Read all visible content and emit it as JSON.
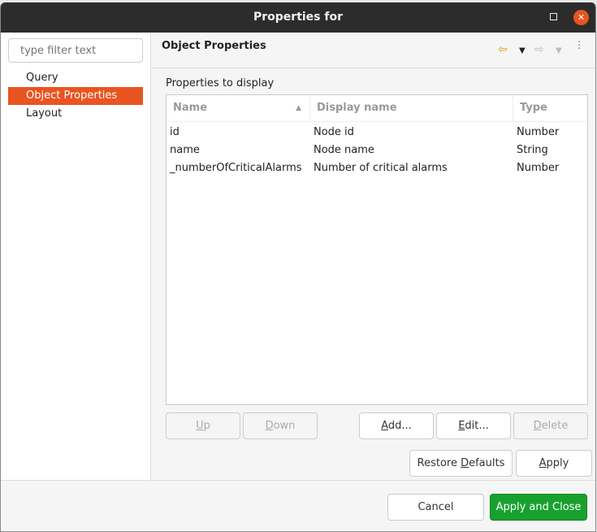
{
  "window": {
    "title": "Properties for"
  },
  "sidebar": {
    "filter_placeholder": "type filter text",
    "items": [
      {
        "label": "Query"
      },
      {
        "label": "Object Properties"
      },
      {
        "label": "Layout"
      }
    ]
  },
  "page": {
    "title": "Object Properties",
    "subtitle": "Properties to display"
  },
  "table": {
    "columns": [
      {
        "label": "Name"
      },
      {
        "label": "Display name"
      },
      {
        "label": "Type"
      }
    ],
    "sort_indicator": "▲",
    "rows": [
      {
        "name": "id",
        "display": "Node id",
        "type": "Number"
      },
      {
        "name": "name",
        "display": "Node name",
        "type": "String"
      },
      {
        "name": "_numberOfCriticalAlarms",
        "display": "Number of critical alarms",
        "type": "Number"
      }
    ]
  },
  "buttons": {
    "up": "Up",
    "down": "Down",
    "add": "Add...",
    "edit": "Edit...",
    "delete": "Delete",
    "restore_pre": "Restore ",
    "restore_key": "D",
    "restore_post": "efaults",
    "apply": "Apply",
    "cancel": "Cancel",
    "apply_close": "Apply and Close"
  },
  "colors": {
    "accent": "#e95420",
    "primary": "#18a12e"
  }
}
